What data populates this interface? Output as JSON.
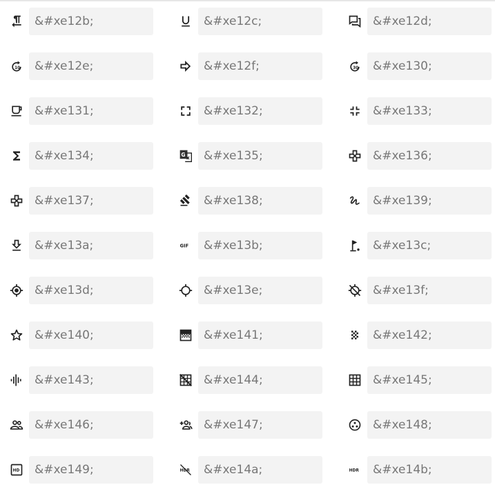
{
  "icons": [
    {
      "name": "format-textdirection-r-to-l-icon",
      "code": "&#xe12b;"
    },
    {
      "name": "format-underlined-icon",
      "code": "&#xe12c;"
    },
    {
      "name": "forum-icon",
      "code": "&#xe12d;"
    },
    {
      "name": "forward-10-icon",
      "code": "&#xe12e;"
    },
    {
      "name": "forward-arrow-icon",
      "code": "&#xe12f;"
    },
    {
      "name": "forward-30-icon",
      "code": "&#xe130;"
    },
    {
      "name": "free-breakfast-icon",
      "code": "&#xe131;"
    },
    {
      "name": "fullscreen-icon",
      "code": "&#xe132;"
    },
    {
      "name": "fullscreen-exit-icon",
      "code": "&#xe133;"
    },
    {
      "name": "functions-icon",
      "code": "&#xe134;"
    },
    {
      "name": "g-translate-icon",
      "code": "&#xe135;"
    },
    {
      "name": "gamepad-icon",
      "code": "&#xe136;"
    },
    {
      "name": "games-icon",
      "code": "&#xe137;"
    },
    {
      "name": "gavel-icon",
      "code": "&#xe138;"
    },
    {
      "name": "gesture-icon",
      "code": "&#xe139;"
    },
    {
      "name": "get-app-icon",
      "code": "&#xe13a;"
    },
    {
      "name": "gif-icon",
      "code": "&#xe13b;"
    },
    {
      "name": "golf-course-icon",
      "code": "&#xe13c;"
    },
    {
      "name": "gps-fixed-icon",
      "code": "&#xe13d;"
    },
    {
      "name": "gps-not-fixed-icon",
      "code": "&#xe13e;"
    },
    {
      "name": "gps-off-icon",
      "code": "&#xe13f;"
    },
    {
      "name": "grade-star-icon",
      "code": "&#xe140;"
    },
    {
      "name": "gradient-icon",
      "code": "&#xe141;"
    },
    {
      "name": "grain-icon",
      "code": "&#xe142;"
    },
    {
      "name": "graphic-eq-icon",
      "code": "&#xe143;"
    },
    {
      "name": "grid-off-icon",
      "code": "&#xe144;"
    },
    {
      "name": "grid-on-icon",
      "code": "&#xe145;"
    },
    {
      "name": "group-icon",
      "code": "&#xe146;"
    },
    {
      "name": "group-add-icon",
      "code": "&#xe147;"
    },
    {
      "name": "group-work-icon",
      "code": "&#xe148;"
    },
    {
      "name": "hd-icon",
      "code": "&#xe149;"
    },
    {
      "name": "hdr-off-icon",
      "code": "&#xe14a;"
    },
    {
      "name": "hdr-on-icon",
      "code": "&#xe14b;"
    }
  ],
  "icon_labels": {
    "gif": "GIF",
    "hd": "HD",
    "hdr": "HDR"
  }
}
